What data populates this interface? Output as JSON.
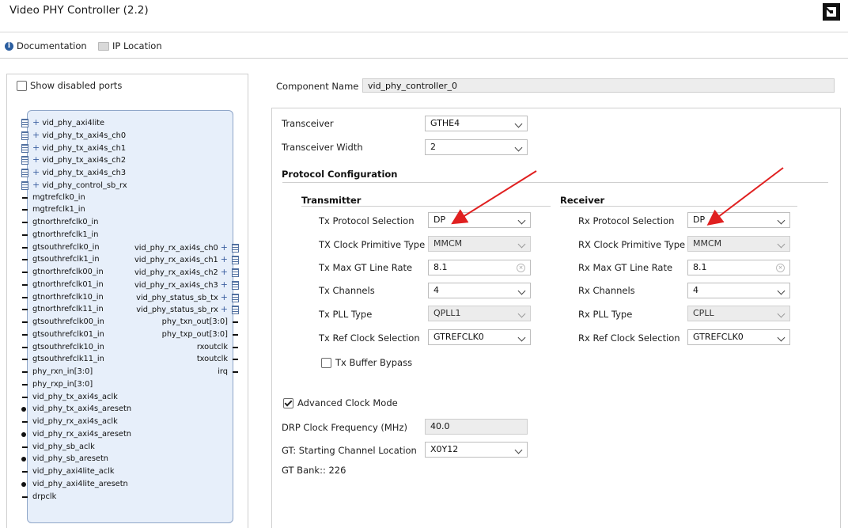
{
  "window": {
    "title": "Video PHY Controller (2.2)"
  },
  "toolbar": {
    "documentation": "Documentation",
    "ip_location": "IP Location"
  },
  "left_panel": {
    "show_disabled_ports": "Show disabled ports",
    "left_ports": [
      {
        "name": "vid_phy_axi4lite",
        "kind": "bus"
      },
      {
        "name": "vid_phy_tx_axi4s_ch0",
        "kind": "bus"
      },
      {
        "name": "vid_phy_tx_axi4s_ch1",
        "kind": "bus"
      },
      {
        "name": "vid_phy_tx_axi4s_ch2",
        "kind": "bus"
      },
      {
        "name": "vid_phy_tx_axi4s_ch3",
        "kind": "bus"
      },
      {
        "name": "vid_phy_control_sb_rx",
        "kind": "bus"
      },
      {
        "name": "mgtrefclk0_in",
        "kind": "pin"
      },
      {
        "name": "mgtrefclk1_in",
        "kind": "pin"
      },
      {
        "name": "gtnorthrefclk0_in",
        "kind": "pin"
      },
      {
        "name": "gtnorthrefclk1_in",
        "kind": "pin"
      },
      {
        "name": "gtsouthrefclk0_in",
        "kind": "pin"
      },
      {
        "name": "gtsouthrefclk1_in",
        "kind": "pin"
      },
      {
        "name": "gtnorthrefclk00_in",
        "kind": "pin"
      },
      {
        "name": "gtnorthrefclk01_in",
        "kind": "pin"
      },
      {
        "name": "gtnorthrefclk10_in",
        "kind": "pin"
      },
      {
        "name": "gtnorthrefclk11_in",
        "kind": "pin"
      },
      {
        "name": "gtsouthrefclk00_in",
        "kind": "pin"
      },
      {
        "name": "gtsouthrefclk01_in",
        "kind": "pin"
      },
      {
        "name": "gtsouthrefclk10_in",
        "kind": "pin"
      },
      {
        "name": "gtsouthrefclk11_in",
        "kind": "pin"
      },
      {
        "name": "phy_rxn_in[3:0]",
        "kind": "pin"
      },
      {
        "name": "phy_rxp_in[3:0]",
        "kind": "pin"
      },
      {
        "name": "vid_phy_tx_axi4s_aclk",
        "kind": "pin"
      },
      {
        "name": "vid_phy_tx_axi4s_aresetn",
        "kind": "dot"
      },
      {
        "name": "vid_phy_rx_axi4s_aclk",
        "kind": "pin"
      },
      {
        "name": "vid_phy_rx_axi4s_aresetn",
        "kind": "dot"
      },
      {
        "name": "vid_phy_sb_aclk",
        "kind": "pin"
      },
      {
        "name": "vid_phy_sb_aresetn",
        "kind": "dot"
      },
      {
        "name": "vid_phy_axi4lite_aclk",
        "kind": "pin"
      },
      {
        "name": "vid_phy_axi4lite_aresetn",
        "kind": "dot"
      },
      {
        "name": "drpclk",
        "kind": "pin"
      }
    ],
    "right_ports": [
      {
        "name": "vid_phy_rx_axi4s_ch0",
        "kind": "bus",
        "row": 10
      },
      {
        "name": "vid_phy_rx_axi4s_ch1",
        "kind": "bus",
        "row": 11
      },
      {
        "name": "vid_phy_rx_axi4s_ch2",
        "kind": "bus",
        "row": 12
      },
      {
        "name": "vid_phy_rx_axi4s_ch3",
        "kind": "bus",
        "row": 13
      },
      {
        "name": "vid_phy_status_sb_tx",
        "kind": "bus",
        "row": 14
      },
      {
        "name": "vid_phy_status_sb_rx",
        "kind": "bus",
        "row": 15
      },
      {
        "name": "phy_txn_out[3:0]",
        "kind": "pin",
        "row": 16
      },
      {
        "name": "phy_txp_out[3:0]",
        "kind": "pin",
        "row": 17
      },
      {
        "name": "rxoutclk",
        "kind": "pin",
        "row": 18
      },
      {
        "name": "txoutclk",
        "kind": "pin",
        "row": 19
      },
      {
        "name": "irq",
        "kind": "pin",
        "row": 20
      }
    ]
  },
  "component": {
    "label": "Component Name",
    "value": "vid_phy_controller_0"
  },
  "general": {
    "transceiver_label": "Transceiver",
    "transceiver_value": "GTHE4",
    "width_label": "Transceiver Width",
    "width_value": "2"
  },
  "protocol": {
    "heading": "Protocol Configuration",
    "tx": {
      "heading": "Transmitter",
      "protocol_label": "Tx Protocol Selection",
      "protocol_value": "DP",
      "clock_prim_label": "TX Clock Primitive Type",
      "clock_prim_value": "MMCM",
      "line_rate_label": "Tx Max GT Line Rate",
      "line_rate_value": "8.1",
      "channels_label": "Tx Channels",
      "channels_value": "4",
      "pll_label": "Tx PLL Type",
      "pll_value": "QPLL1",
      "refclk_label": "Tx Ref Clock Selection",
      "refclk_value": "GTREFCLK0",
      "buffer_bypass_label": "Tx Buffer Bypass"
    },
    "rx": {
      "heading": "Receiver",
      "protocol_label": "Rx Protocol Selection",
      "protocol_value": "DP",
      "clock_prim_label": "RX Clock Primitive Type",
      "clock_prim_value": "MMCM",
      "line_rate_label": "Rx Max GT Line Rate",
      "line_rate_value": "8.1",
      "channels_label": "Rx Channels",
      "channels_value": "4",
      "pll_label": "Rx PLL Type",
      "pll_value": "CPLL",
      "refclk_label": "Rx Ref Clock Selection",
      "refclk_value": "GTREFCLK0"
    }
  },
  "advanced": {
    "adv_clock_label": "Advanced Clock Mode",
    "drp_label": "DRP Clock Frequency (MHz)",
    "drp_value": "40.0",
    "gt_loc_label": "GT: Starting Channel Location",
    "gt_loc_value": "X0Y12",
    "gt_bank_text": "GT Bank:: 226"
  },
  "colors": {
    "arrow": "#e02020",
    "block_fill": "#e7effa",
    "block_border": "#8fa6c8"
  }
}
